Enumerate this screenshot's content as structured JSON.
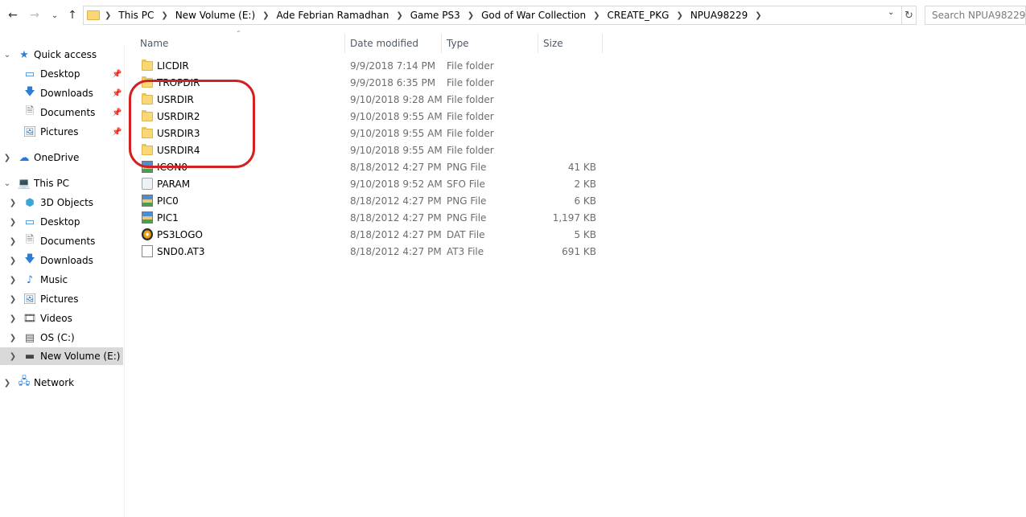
{
  "address": {
    "crumbs": [
      "This PC",
      "New Volume (E:)",
      "Ade Febrian Ramadhan",
      "Game PS3",
      "God of War Collection",
      "CREATE_PKG",
      "NPUA98229"
    ],
    "search_placeholder": "Search NPUA98229"
  },
  "sidebar": {
    "quick_access": "Quick access",
    "quick_items": [
      "Desktop",
      "Downloads",
      "Documents",
      "Pictures"
    ],
    "onedrive": "OneDrive",
    "this_pc": "This PC",
    "pc_items": [
      "3D Objects",
      "Desktop",
      "Documents",
      "Downloads",
      "Music",
      "Pictures",
      "Videos",
      "OS (C:)",
      "New Volume (E:)"
    ],
    "network": "Network"
  },
  "columns": {
    "name": "Name",
    "date": "Date modified",
    "type": "Type",
    "size": "Size"
  },
  "files": [
    {
      "name": "LICDIR",
      "date": "9/9/2018 7:14 PM",
      "type": "File folder",
      "size": "",
      "icon": "folder-icon"
    },
    {
      "name": "TROPDIR",
      "date": "9/9/2018 6:35 PM",
      "type": "File folder",
      "size": "",
      "icon": "folder-icon"
    },
    {
      "name": "USRDIR",
      "date": "9/10/2018 9:28 AM",
      "type": "File folder",
      "size": "",
      "icon": "folder-icon"
    },
    {
      "name": "USRDIR2",
      "date": "9/10/2018 9:55 AM",
      "type": "File folder",
      "size": "",
      "icon": "folder-icon"
    },
    {
      "name": "USRDIR3",
      "date": "9/10/2018 9:55 AM",
      "type": "File folder",
      "size": "",
      "icon": "folder-icon"
    },
    {
      "name": "USRDIR4",
      "date": "9/10/2018 9:55 AM",
      "type": "File folder",
      "size": "",
      "icon": "folder-icon"
    },
    {
      "name": "ICON0",
      "date": "8/18/2012 4:27 PM",
      "type": "PNG File",
      "size": "41 KB",
      "icon": "png-file-icon"
    },
    {
      "name": "PARAM",
      "date": "9/10/2018 9:52 AM",
      "type": "SFO File",
      "size": "2 KB",
      "icon": "sfo-file-icon"
    },
    {
      "name": "PIC0",
      "date": "8/18/2012 4:27 PM",
      "type": "PNG File",
      "size": "6 KB",
      "icon": "png-file-icon"
    },
    {
      "name": "PIC1",
      "date": "8/18/2012 4:27 PM",
      "type": "PNG File",
      "size": "1,197 KB",
      "icon": "png-file-icon"
    },
    {
      "name": "PS3LOGO",
      "date": "8/18/2012 4:27 PM",
      "type": "DAT File",
      "size": "5 KB",
      "icon": "dat-file-icon"
    },
    {
      "name": "SND0.AT3",
      "date": "8/18/2012 4:27 PM",
      "type": "AT3 File",
      "size": "691 KB",
      "icon": "at3-file-icon"
    }
  ],
  "colors": {
    "selection": "#d9d9d9",
    "header_text": "#4d5a6b",
    "annotation": "#d32020",
    "folder": "#f8d774"
  }
}
